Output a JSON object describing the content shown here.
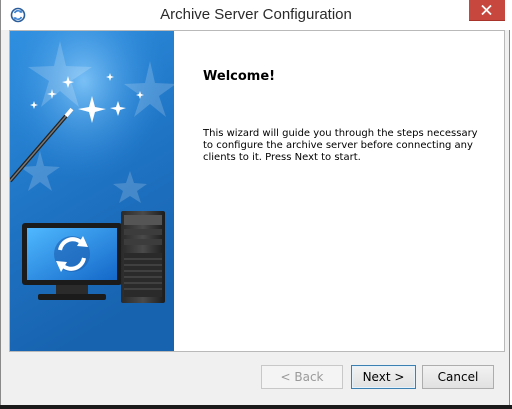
{
  "window": {
    "title": "Archive Server Configuration"
  },
  "content": {
    "heading": "Welcome!",
    "body": "This wizard will guide you through the steps necessary to configure the archive server before connecting any clients to it. Press Next to start."
  },
  "buttons": {
    "back": "< Back",
    "next": "Next >",
    "cancel": "Cancel"
  },
  "colors": {
    "close_button": "#c7463d",
    "banner_blue": "#1f74c4",
    "primary_border": "#3c7fb1"
  },
  "icons": {
    "app": "refresh-icon",
    "close": "close-icon"
  }
}
